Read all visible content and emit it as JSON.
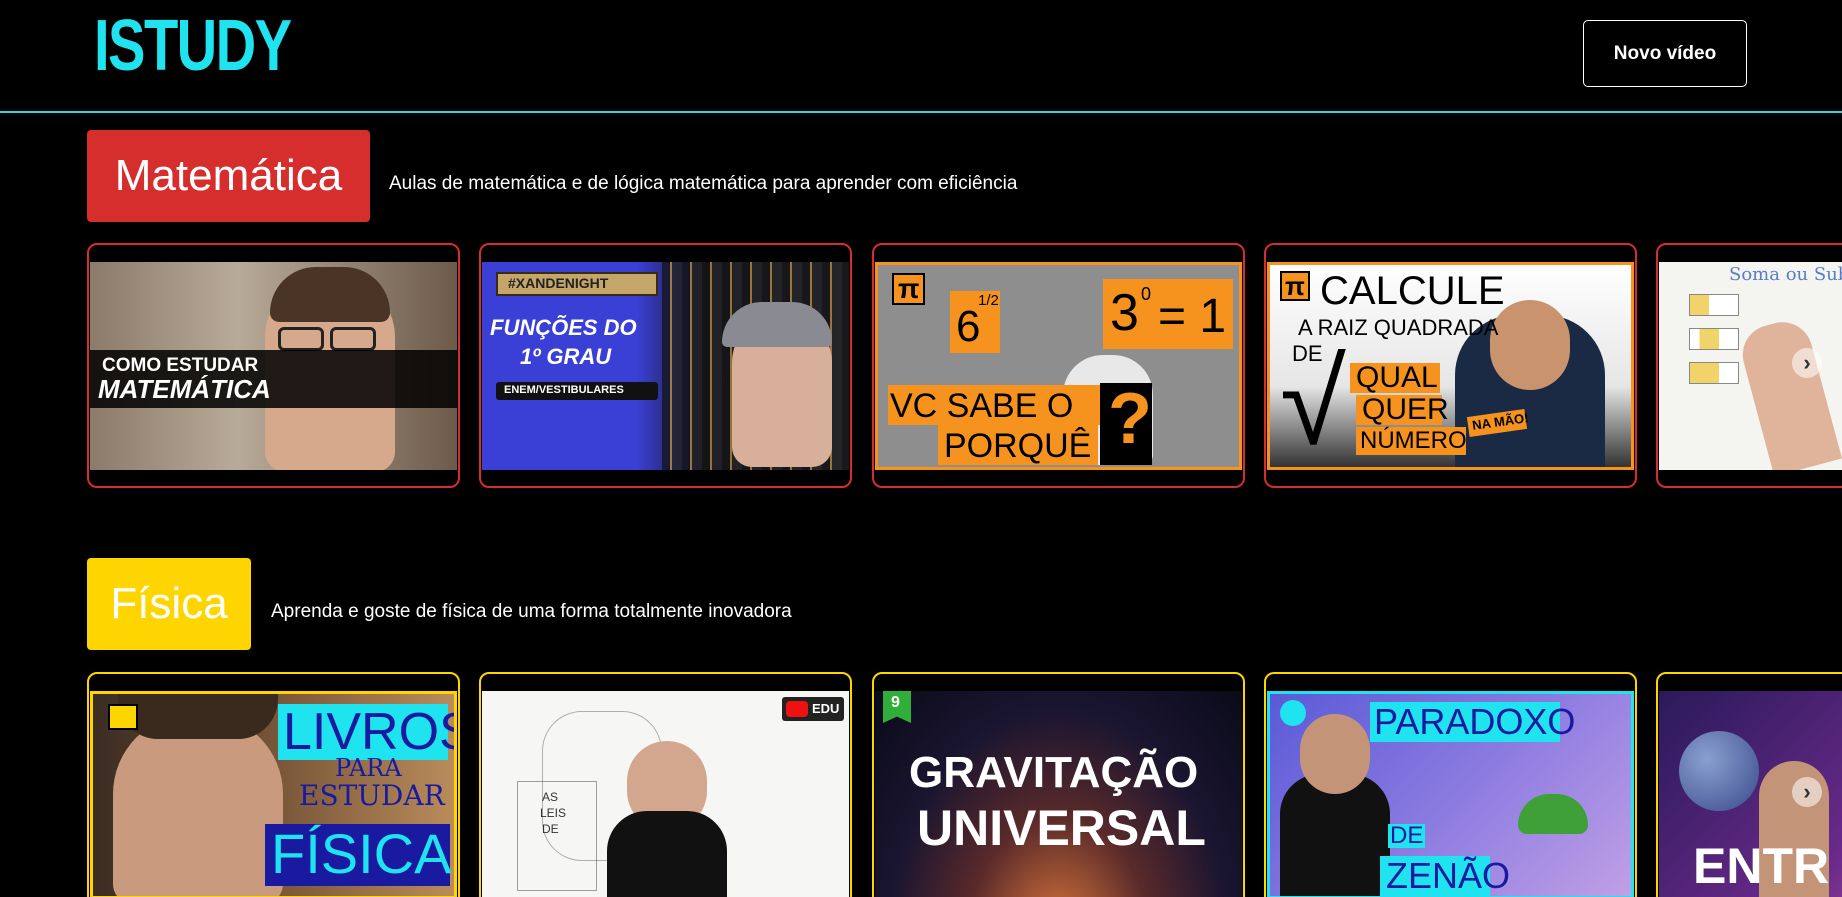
{
  "header": {
    "logo": "ISTUDY",
    "new_video_label": "Novo vídeo"
  },
  "colors": {
    "accent": "#1fe3ef",
    "math": "#d62d2d",
    "physics": "#ffd500"
  },
  "sections": [
    {
      "title": "Matemática",
      "description": "Aulas de matemática e de lógica matemática para aprender com eficiência",
      "videos": [
        {
          "line1": "COMO ESTUDAR",
          "line2": "MATEMÁTICA"
        },
        {
          "tag": "#XANDENIGHT",
          "line1": "FUNÇÕES DO",
          "line2": "1º GRAU",
          "line3": "ENEM/VESTIBULARES"
        },
        {
          "pi": "π",
          "frac": "6",
          "fracsup": "1/2",
          "eq": "3",
          "eqsup": "0",
          "eqrest": "= 1",
          "line1": "VC SABE O",
          "line2": "PORQUÊ",
          "q": "?"
        },
        {
          "pi": "π",
          "line1": "CALCULE",
          "line2": "A RAIZ QUADRADA",
          "line3": "DE",
          "line4": "QUAL",
          "line5": "QUER",
          "line6": "NÚMERO",
          "line7": "NA MÃO!"
        },
        {
          "line1": "Soma ou Sub"
        }
      ]
    },
    {
      "title": "Física",
      "description": "Aprenda e goste de física de uma forma totalmente inovadora",
      "videos": [
        {
          "line1": "LIVROS",
          "line2": "PARA",
          "line3": "ESTUDAR",
          "line4": "FÍSICA"
        },
        {
          "edu": "EDU",
          "line1": "AS",
          "line2": "LEIS",
          "line3": "DE"
        },
        {
          "num": "9",
          "line1": "GRAVITAÇÃO",
          "line2": "UNIVERSAL"
        },
        {
          "line1": "PARADOXO",
          "line2": "DE",
          "line3": "ZENÃO"
        },
        {
          "line1": "ENTR"
        }
      ]
    }
  ]
}
